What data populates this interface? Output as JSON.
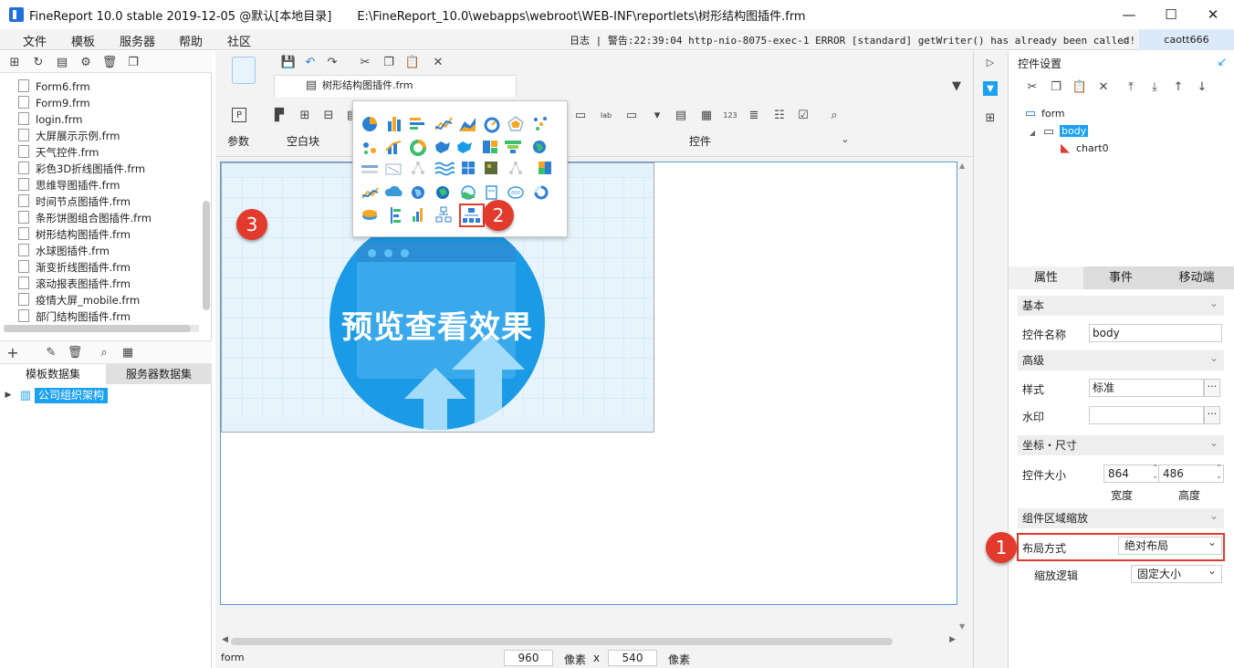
{
  "window": {
    "title": "FineReport 10.0 stable 2019-12-05 @默认[本地目录]",
    "path": "E:\\FineReport_10.0\\webapps\\webroot\\WEB-INF\\reportlets\\树形结构图插件.frm",
    "minimize": "—",
    "maximize": "☐",
    "close": "✕"
  },
  "menu": {
    "items": [
      "文件",
      "模板",
      "服务器",
      "帮助",
      "社区"
    ],
    "log": "日志 | 警告:22:39:04 http-nio-8075-exec-1 ERROR [standard] getWriter() has already been called!",
    "user": "caott666"
  },
  "files": [
    "Form6.frm",
    "Form9.frm",
    "login.frm",
    "大屏展示示例.frm",
    "天气控件.frm",
    "彩色3D折线图插件.frm",
    "思维导图插件.frm",
    "时间节点图插件.frm",
    "条形饼图组合图插件.frm",
    "树形结构图插件.frm",
    "水球图插件.frm",
    "渐变折线图插件.frm",
    "滚动报表图插件.frm",
    "疫情大屏_mobile.frm",
    "部门结构图插件.frm"
  ],
  "datasets": {
    "tab_template": "模板数据集",
    "tab_server": "服务器数据集",
    "item": "公司组织架构"
  },
  "editor": {
    "tab_title": "树形结构图插件.frm",
    "ribbon_param": "参数",
    "ribbon_blank": "空白块",
    "ribbon_widget": "控件",
    "preview_text": "预览查看效果",
    "badge1": "1",
    "badge2": "2",
    "badge3": "3",
    "status_name": "form",
    "width": "960",
    "height": "540",
    "unit": "像素",
    "times": "x"
  },
  "right": {
    "title": "控件设置",
    "tree": {
      "root": "form",
      "body": "body",
      "child": "chart0"
    },
    "tabs": [
      "属性",
      "事件",
      "移动端"
    ],
    "sections": {
      "basic": "基本",
      "advanced": "高级",
      "coord": "坐标・尺寸",
      "zoom": "组件区域缩放"
    },
    "name_label": "控件名称",
    "name_value": "body",
    "style_label": "样式",
    "style_value": "标准",
    "watermark_label": "水印",
    "size_label": "控件大小",
    "size_w": "864",
    "size_h": "486",
    "w_label": "宽度",
    "h_label": "高度",
    "layout_label": "布局方式",
    "layout_value": "绝对布局",
    "scale_label": "缩放逻辑",
    "scale_value": "固定大小",
    "ellipsis": "···"
  }
}
